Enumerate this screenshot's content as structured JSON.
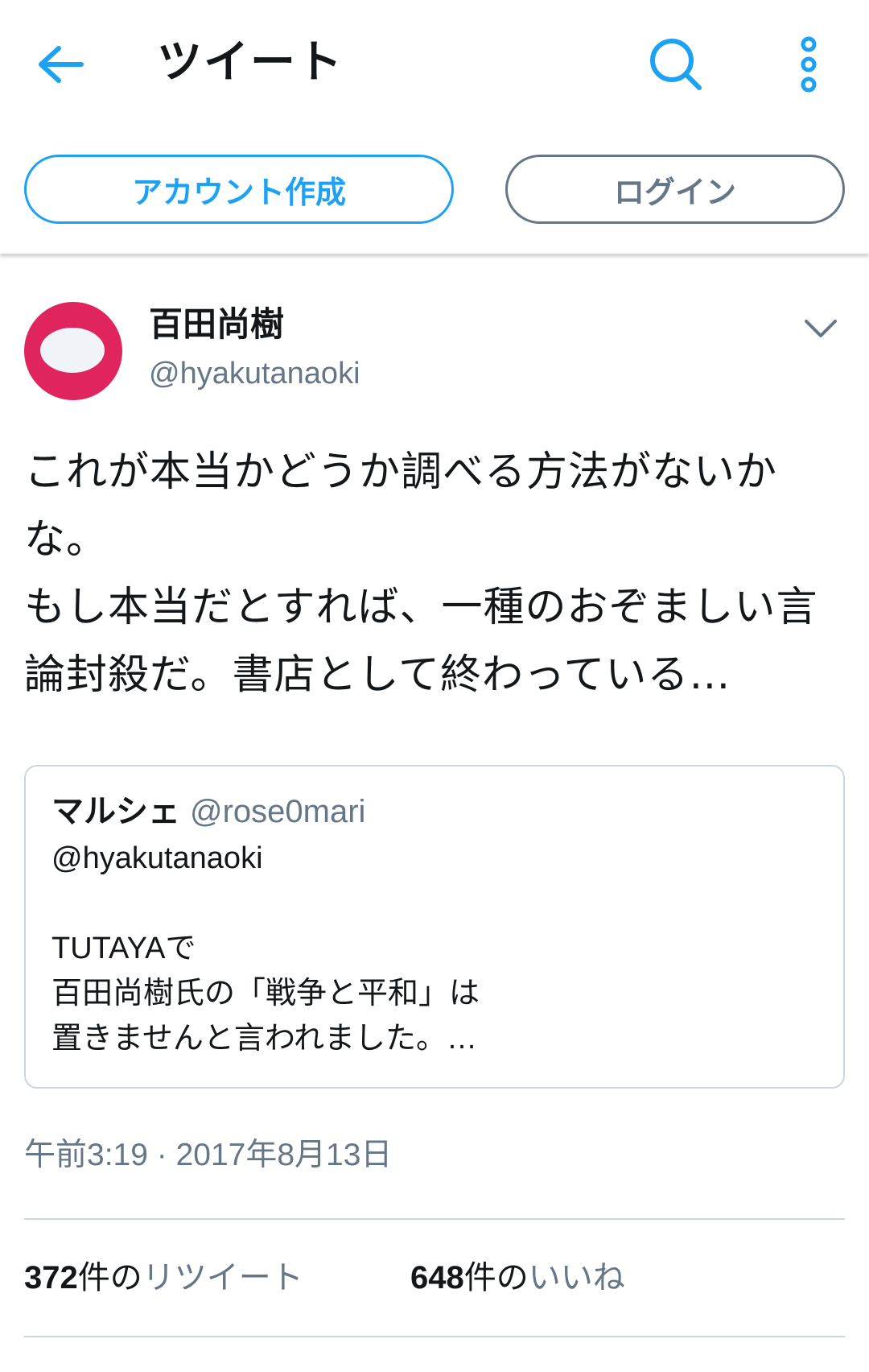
{
  "header": {
    "title": "ツイート",
    "back_icon": "arrow-left-icon",
    "search_icon": "search-icon",
    "more_icon": "vertical-dots-icon"
  },
  "auth": {
    "create_account_label": "アカウント作成",
    "login_label": "ログイン"
  },
  "colors": {
    "accent": "#1da1f2",
    "secondary_text": "#657786",
    "divider": "#ccd6dd",
    "avatar_bg": "#e0245e"
  },
  "tweet": {
    "author_name": "百田尚樹",
    "author_handle": "@hyakutanaoki",
    "text": "これが本当かどうか調べる方法がないかな。\nもし本当だとすれば、一種のおぞましい言論封殺だ。書店として終わっている…",
    "quote": {
      "author_name": "マルシェ",
      "author_handle": "@rose0mari",
      "text": "@hyakutanaoki\n\nTUTAYAで\n百田尚樹氏の「戦争と平和」は\n置きませんと言われました。…"
    },
    "timestamp": "午前3:19 · 2017年8月13日",
    "retweets": {
      "count": "372",
      "unit": "件の",
      "label": "リツイート"
    },
    "likes": {
      "count": "648",
      "unit": "件の",
      "label": "いいね"
    }
  }
}
